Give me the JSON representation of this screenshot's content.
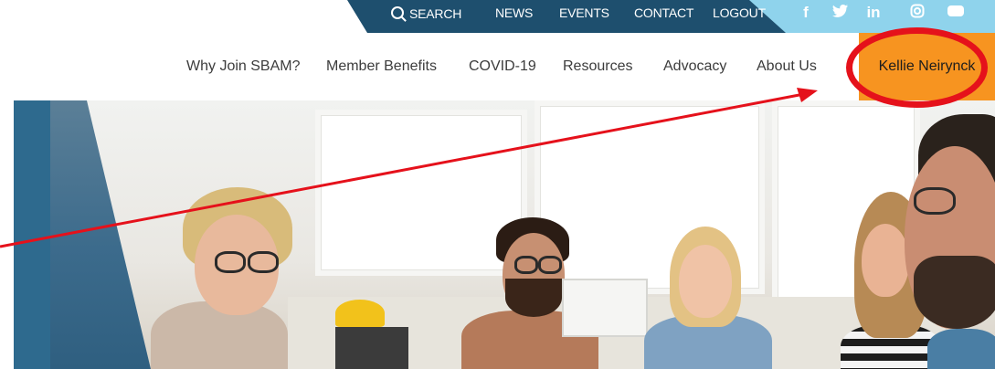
{
  "utility_nav": {
    "search_label": "SEARCH",
    "items": [
      "NEWS",
      "EVENTS",
      "CONTACT",
      "LOGOUT"
    ],
    "social_icons": [
      "facebook-icon",
      "twitter-icon",
      "linkedin-icon",
      "instagram-icon",
      "youtube-icon"
    ],
    "colors": {
      "bar": "#1e4f6e",
      "accent": "#8fd3ec"
    }
  },
  "main_nav": {
    "items": [
      "Why Join SBAM?",
      "Member Benefits",
      "COVID-19",
      "Resources",
      "Advocacy",
      "About Us"
    ],
    "account_label": "Kellie Neirynck",
    "colors": {
      "account_bg": "#f79420"
    }
  },
  "annotation": {
    "color": "#e5111b"
  }
}
